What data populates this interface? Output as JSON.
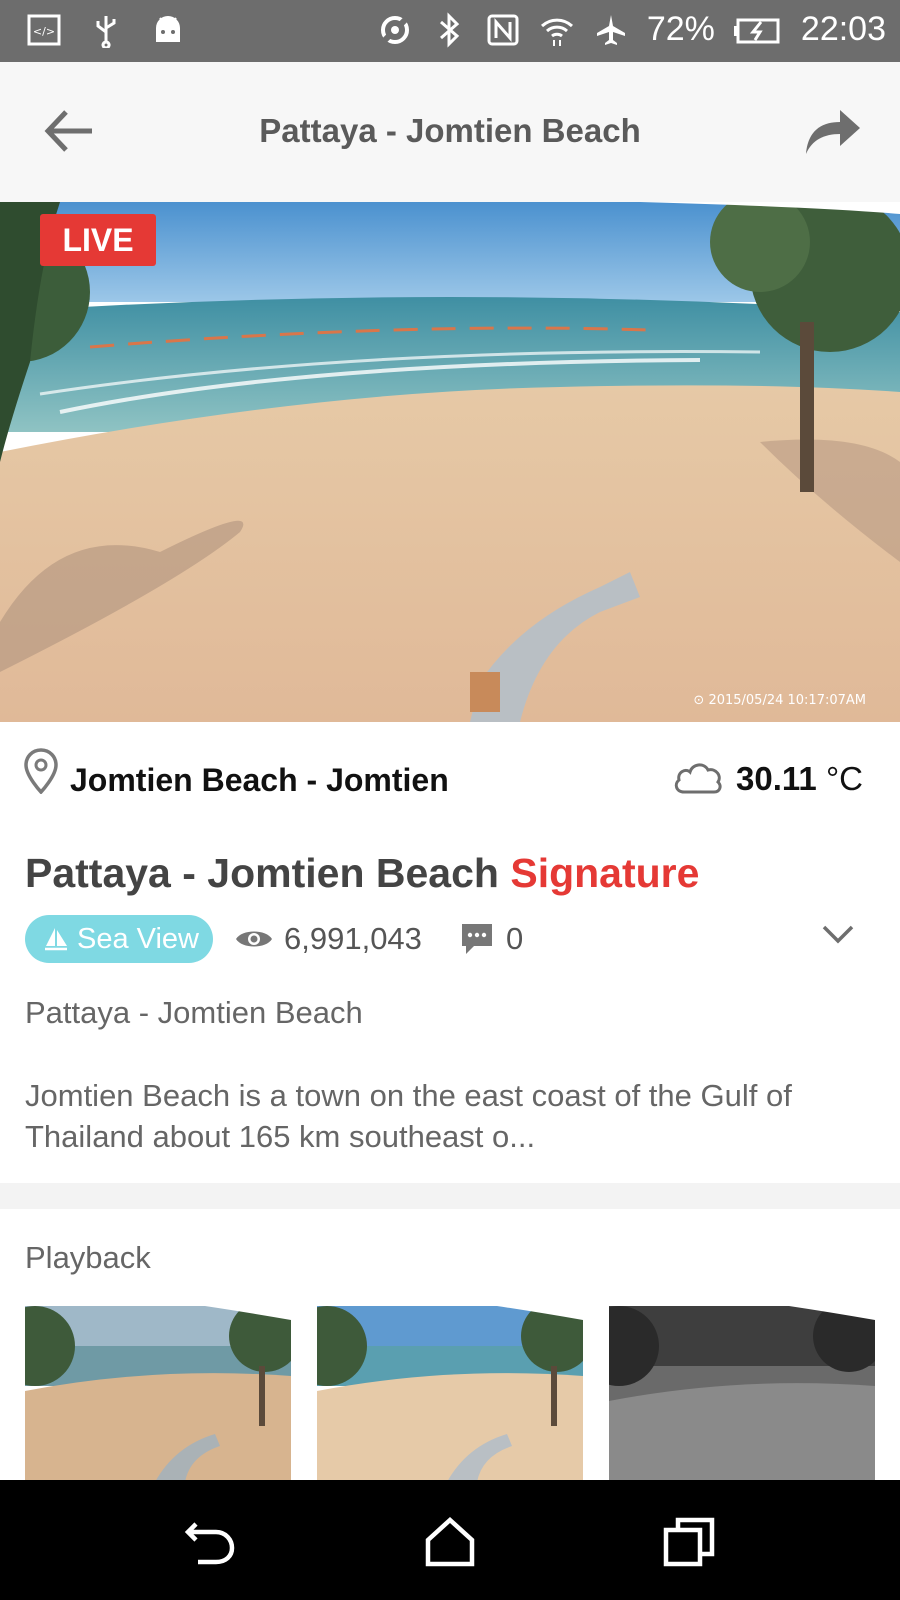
{
  "status_bar": {
    "battery": "72%",
    "time": "22:03",
    "icons": [
      "code-icon",
      "usb-icon",
      "android-icon",
      "hotspot-icon",
      "bluetooth-icon",
      "nfc-icon",
      "wifi-icon",
      "airplane-icon",
      "battery-icon"
    ]
  },
  "header": {
    "title": "Pattaya - Jomtien Beach",
    "back_icon": "arrow-left-icon",
    "share_icon": "share-arrow-icon"
  },
  "video": {
    "live_label": "LIVE",
    "timestamp": "2015/05/24 10:17:07AM"
  },
  "location": {
    "name": "Jomtien Beach - Jomtien",
    "temperature": "30.11",
    "unit": "°C",
    "weather_icon": "cloud-icon"
  },
  "camera": {
    "title_main": "Pattaya - Jomtien Beach",
    "title_accent": "Signature",
    "tag": "Sea View",
    "views": "6,991,043",
    "comments": "0",
    "subtitle": "Pattaya - Jomtien Beach",
    "description": "Jomtien Beach is a town on the east coast of the Gulf of Thailand about 165 km southeast o..."
  },
  "playback": {
    "label": "Playback"
  },
  "colors": {
    "accent_red": "#e53935",
    "tag_cyan": "#7fd9e3",
    "status_bar": "#6d6d6d"
  },
  "nav": {
    "icons": [
      "back-nav-icon",
      "home-nav-icon",
      "recents-nav-icon"
    ]
  }
}
